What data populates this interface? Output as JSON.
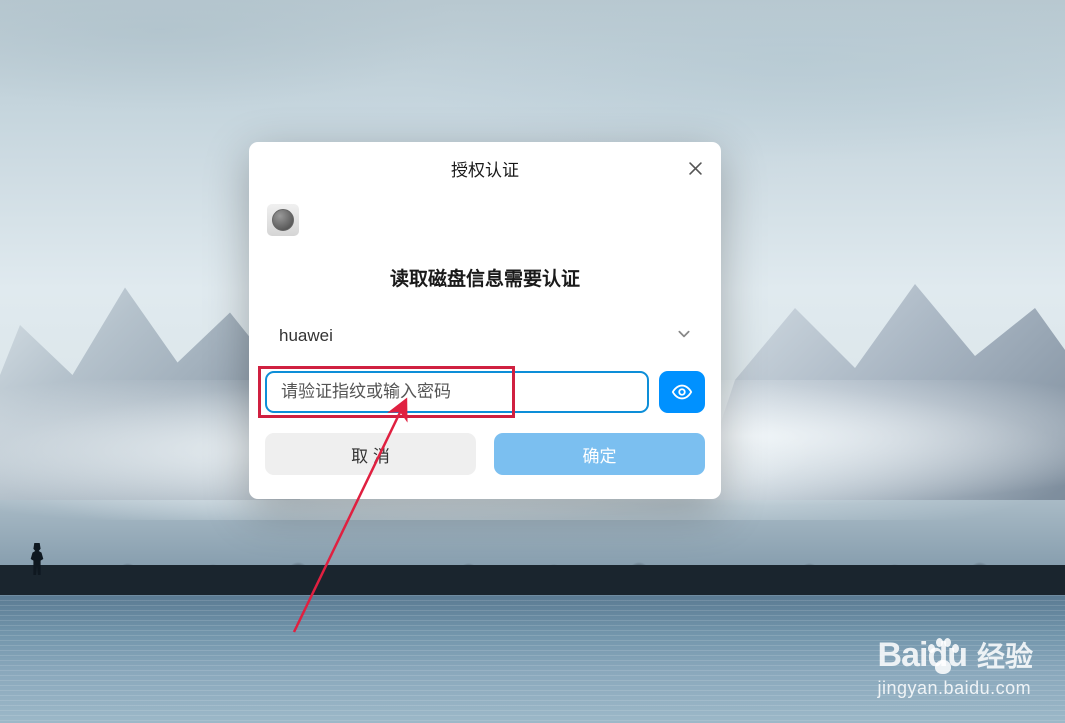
{
  "dialog": {
    "title": "授权认证",
    "message": "读取磁盘信息需要认证",
    "username": "huawei",
    "password_placeholder": "请验证指纹或输入密码",
    "cancel_label": "取 消",
    "ok_label": "确定"
  },
  "watermark": {
    "brand": "Bai",
    "brand_suffix": "du",
    "product": "经验",
    "url": "jingyan.baidu.com"
  },
  "colors": {
    "accent": "#0091ff",
    "focus_border": "#0d8ed8",
    "highlight": "#d02040",
    "ok_button": "#7bbff0"
  }
}
